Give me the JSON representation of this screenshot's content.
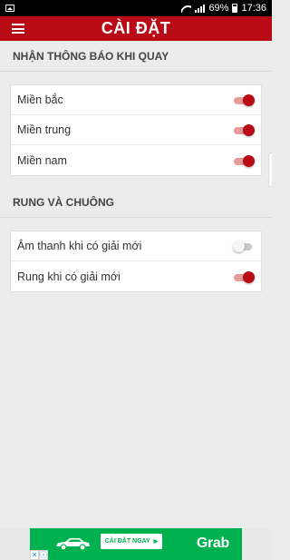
{
  "status_bar": {
    "battery": "69%",
    "time": "17:36"
  },
  "header": {
    "title": "CÀI ĐẶT",
    "menu_icon": "hamburger-menu-icon"
  },
  "sections": [
    {
      "title": "NHẬN THÔNG BÁO KHI QUAY",
      "items": [
        {
          "label": "Miền bắc",
          "enabled": true
        },
        {
          "label": "Miền trung",
          "enabled": true
        },
        {
          "label": "Miền nam",
          "enabled": true
        }
      ]
    },
    {
      "title": "RUNG VÀ CHUÔNG",
      "items": [
        {
          "label": "Âm thanh khi có giải mới",
          "enabled": false
        },
        {
          "label": "Rung khi có giải mới",
          "enabled": true
        }
      ]
    }
  ],
  "ad": {
    "button_label": "CÀI ĐẶT NGAY",
    "brand": "Grab",
    "close_glyph": "✕",
    "info_glyph": "ⓘ",
    "background_color": "#00b14f"
  },
  "colors": {
    "accent": "#b90b16",
    "toggle_on_track": "#e79a9a",
    "toggle_off_track": "#c8c8c8"
  }
}
